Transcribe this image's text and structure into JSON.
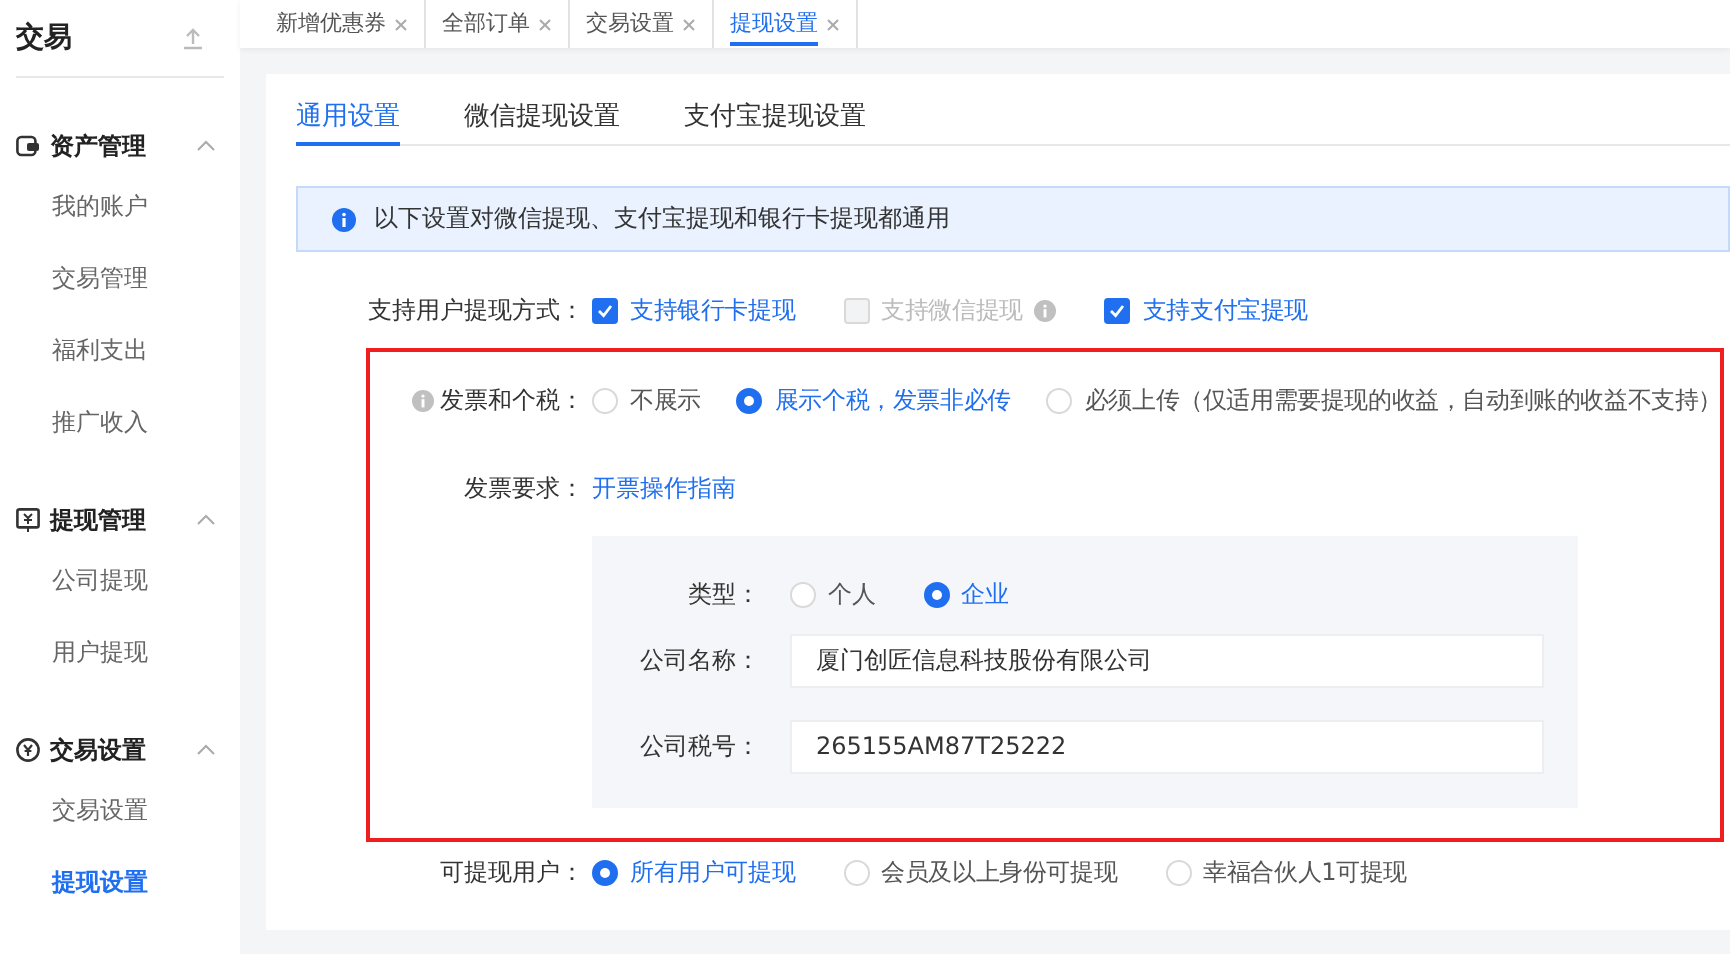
{
  "sidebar": {
    "title": "交易",
    "groups": [
      {
        "label": "资产管理",
        "expanded": true,
        "items": [
          {
            "label": "我的账户",
            "selected": false
          },
          {
            "label": "交易管理",
            "selected": false
          },
          {
            "label": "福利支出",
            "selected": false
          },
          {
            "label": "推广收入",
            "selected": false
          }
        ]
      },
      {
        "label": "提现管理",
        "expanded": true,
        "items": [
          {
            "label": "公司提现",
            "selected": false
          },
          {
            "label": "用户提现",
            "selected": false
          }
        ]
      },
      {
        "label": "交易设置",
        "expanded": true,
        "items": [
          {
            "label": "交易设置",
            "selected": false
          },
          {
            "label": "提现设置",
            "selected": true
          }
        ]
      }
    ]
  },
  "page_tabs": [
    {
      "label": "新增优惠券",
      "selected": false
    },
    {
      "label": "全部订单",
      "selected": false
    },
    {
      "label": "交易设置",
      "selected": false
    },
    {
      "label": "提现设置",
      "selected": true
    }
  ],
  "sub_tabs": [
    {
      "label": "通用设置",
      "selected": true
    },
    {
      "label": "微信提现设置",
      "selected": false
    },
    {
      "label": "支付宝提现设置",
      "selected": false
    }
  ],
  "notice": "以下设置对微信提现、支付宝提现和银行卡提现都通用",
  "withdraw_methods": {
    "label": "支持用户提现方式：",
    "options": [
      {
        "label": "支持银行卡提现",
        "checked": true,
        "disabled": false,
        "info": false
      },
      {
        "label": "支持微信提现",
        "checked": false,
        "disabled": true,
        "info": true
      },
      {
        "label": "支持支付宝提现",
        "checked": true,
        "disabled": false,
        "info": false
      }
    ]
  },
  "invoice_tax": {
    "label": "发票和个税：",
    "info": true,
    "options": [
      {
        "label": "不展示",
        "selected": false
      },
      {
        "label": "展示个税，发票非必传",
        "selected": true
      },
      {
        "label": "必须上传（仅适用需要提现的收益，自动到账的收益不支持）",
        "selected": false
      }
    ]
  },
  "invoice_requirement": {
    "label": "发票要求：",
    "link": "开票操作指南"
  },
  "invoice_form": {
    "type": {
      "label": "类型：",
      "options": [
        {
          "label": "个人",
          "selected": false
        },
        {
          "label": "企业",
          "selected": true
        }
      ]
    },
    "fields": [
      {
        "label": "公司名称：",
        "value": "厦门创匠信息科技股份有限公司"
      },
      {
        "label": "公司税号：",
        "value": "265155AM87T25222"
      }
    ]
  },
  "eligible_users": {
    "label": "可提现用户：",
    "options": [
      {
        "label": "所有用户可提现",
        "selected": true
      },
      {
        "label": "会员及以上身份可提现",
        "selected": false
      },
      {
        "label": "幸福合伙人1可提现",
        "selected": false
      }
    ]
  }
}
